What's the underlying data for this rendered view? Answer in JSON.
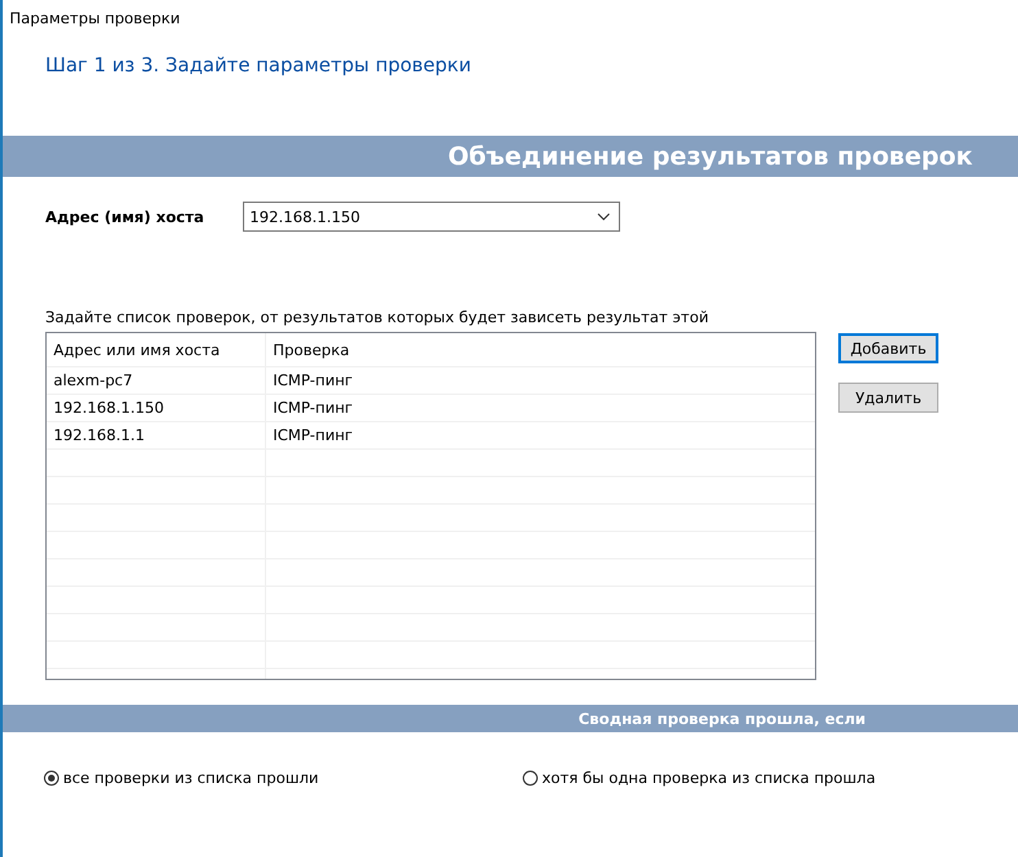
{
  "window": {
    "title": "Параметры проверки"
  },
  "step_title": "Шаг 1 из 3. Задайте параметры проверки",
  "section_header": "Объединение результатов проверок",
  "host": {
    "label": "Адрес (имя) хоста",
    "value": "192.168.1.150"
  },
  "list_caption": "Задайте список проверок, от результатов которых будет зависеть результат этой",
  "table": {
    "columns": [
      "Адрес или имя хоста",
      "Проверка"
    ],
    "rows": [
      [
        "alexm-pc7",
        "ICMP-пинг"
      ],
      [
        "192.168.1.150",
        "ICMP-пинг"
      ],
      [
        "192.168.1.1",
        "ICMP-пинг"
      ]
    ]
  },
  "buttons": [
    {
      "label": "Добавить",
      "focused": true
    },
    {
      "label": "Удалить",
      "focused": false
    }
  ],
  "summary_header": "Сводная проверка прошла, если",
  "options": [
    {
      "label": "все проверки из списка прошли",
      "selected": true
    },
    {
      "label": "хотя бы одна проверка из списка прошла",
      "selected": false
    }
  ]
}
